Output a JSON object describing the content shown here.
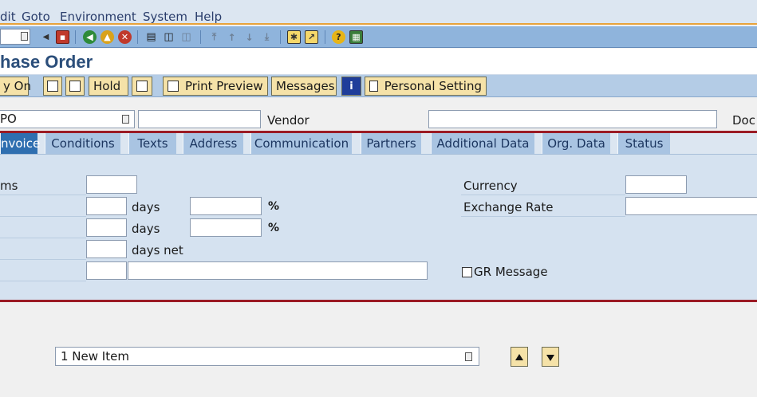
{
  "menu": {
    "items": [
      "dit",
      "Goto",
      "Environment",
      "System",
      "Help"
    ]
  },
  "toolbar": {
    "icons": [
      "back-icon",
      "save-icon",
      "green-back-icon",
      "exit-icon",
      "cancel-icon",
      "print-icon",
      "find-icon",
      "find-next-icon",
      "first-page-icon",
      "prev-page-icon",
      "next-page-icon",
      "last-page-icon",
      "create-session-icon",
      "shortcut-icon",
      "help-icon",
      "customize-layout-icon"
    ]
  },
  "title": "hase Order",
  "app_toolbar": {
    "buttons": [
      {
        "label": "y On"
      },
      {
        "label": ""
      },
      {
        "label": ""
      },
      {
        "label": "Hold"
      },
      {
        "label": ""
      },
      {
        "label": "Print Preview"
      },
      {
        "label": "Messages"
      },
      {
        "label": ""
      },
      {
        "label": "Personal Setting"
      }
    ]
  },
  "header": {
    "doc_type_value": "PO",
    "doc_number_value": "",
    "vendor_label": "Vendor",
    "vendor_value": "",
    "doc_date_label": "Doc"
  },
  "tabs": [
    {
      "label": "nvoice",
      "active": true
    },
    {
      "label": "Conditions"
    },
    {
      "label": "Texts"
    },
    {
      "label": "Address"
    },
    {
      "label": "Communication"
    },
    {
      "label": "Partners"
    },
    {
      "label": "Additional Data"
    },
    {
      "label": "Org. Data"
    },
    {
      "label": "Status"
    }
  ],
  "invoice": {
    "payment_terms_label": "ms",
    "days1_label": "days",
    "days2_label": "days",
    "days_net_label": "days net",
    "pct1": "%",
    "pct2": "%",
    "currency_label": "Currency",
    "exchange_rate_label": "Exchange Rate",
    "gr_message_label": "GR Message"
  },
  "items": {
    "selected": "1 New Item"
  },
  "colors": {
    "accent_red": "#9b1b25",
    "tab_active": "#2f6fb0",
    "button_bg": "#f5e2a8"
  }
}
